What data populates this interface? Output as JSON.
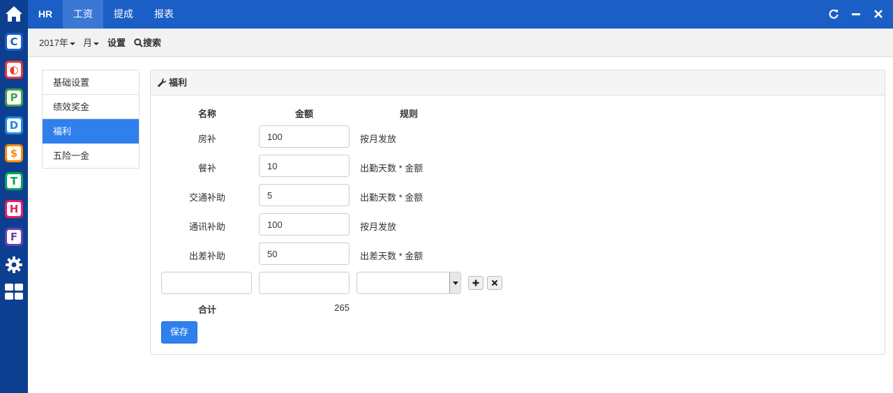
{
  "rail": {
    "apps": [
      {
        "icon": "c-app-icon",
        "letter": "C",
        "color": "#1b5ec5"
      },
      {
        "icon": "o-app-icon",
        "letter": "◐",
        "color": "#e53935"
      },
      {
        "icon": "p-app-icon",
        "letter": "P",
        "color": "#43a047"
      },
      {
        "icon": "d-app-icon",
        "letter": "D",
        "color": "#1e88e5"
      },
      {
        "icon": "s-app-icon",
        "letter": "$",
        "color": "#fb8c00"
      },
      {
        "icon": "t-app-icon",
        "letter": "T",
        "color": "#00a651"
      },
      {
        "icon": "h-app-icon",
        "letter": "H",
        "color": "#e91e63"
      },
      {
        "icon": "f-app-icon",
        "letter": "F",
        "color": "#6a3fb5"
      }
    ]
  },
  "topbar": {
    "brand": "HR",
    "tabs": [
      "工资",
      "提成",
      "报表"
    ],
    "active_tab": "工资",
    "color": "#1b5ec5"
  },
  "subbar": {
    "year": "2017年",
    "month": "月",
    "settings": "设置",
    "search": "搜索"
  },
  "sidenav": {
    "items": [
      "基础设置",
      "绩效奖金",
      "福利",
      "五险一金"
    ],
    "active": "福利"
  },
  "panel": {
    "title": "福利",
    "headers": {
      "name": "名称",
      "amount": "金额",
      "rule": "规则"
    },
    "rows": [
      {
        "name": "房补",
        "amount": "100",
        "rule": "按月发放"
      },
      {
        "name": "餐补",
        "amount": "10",
        "rule": "出勤天数 * 金额"
      },
      {
        "name": "交通补助",
        "amount": "5",
        "rule": "出勤天数 * 金额"
      },
      {
        "name": "通讯补助",
        "amount": "100",
        "rule": "按月发放"
      },
      {
        "name": "出差补助",
        "amount": "50",
        "rule": "出差天数 * 金额"
      }
    ],
    "total_label": "合计",
    "total_value": "265",
    "save_label": "保存"
  }
}
